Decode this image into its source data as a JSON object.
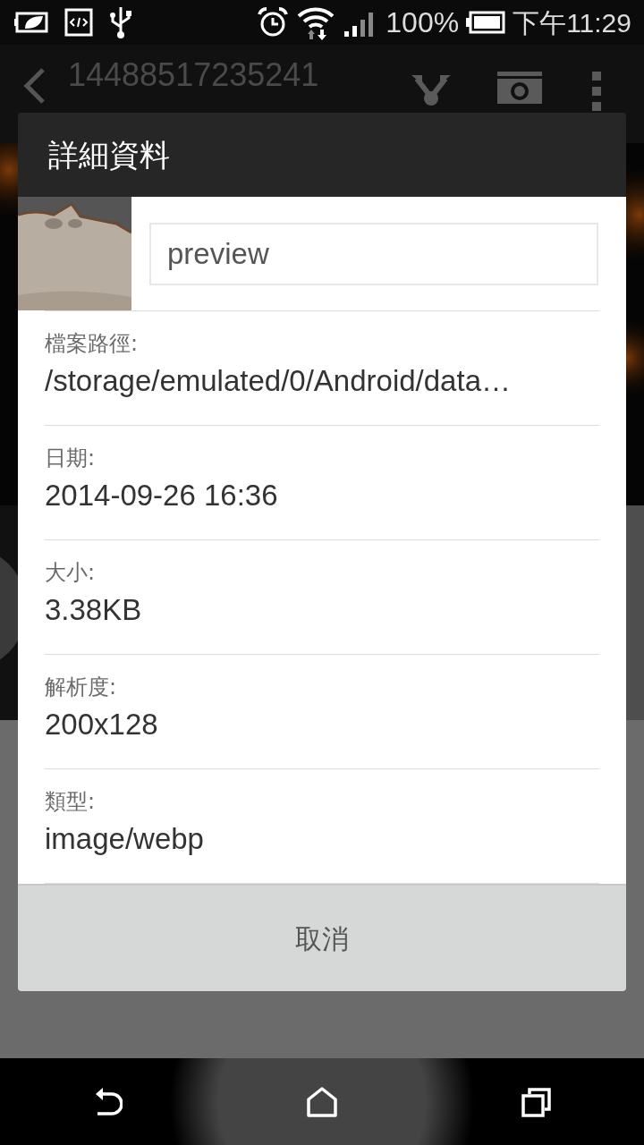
{
  "status_bar": {
    "battery_percent": "100%",
    "time": "下午11:29"
  },
  "action_bar": {
    "title": "14488517235241"
  },
  "dialog": {
    "title": "詳細資料",
    "name_field": {
      "value": "preview"
    },
    "details": [
      {
        "label": "檔案路徑:",
        "value": "/storage/emulated/0/Android/data…"
      },
      {
        "label": "日期:",
        "value": "2014-09-26 16:36"
      },
      {
        "label": "大小:",
        "value": "3.38KB"
      },
      {
        "label": "解析度:",
        "value": "200x128"
      },
      {
        "label": "類型:",
        "value": "image/webp"
      }
    ],
    "buttons": [
      "取消"
    ]
  }
}
